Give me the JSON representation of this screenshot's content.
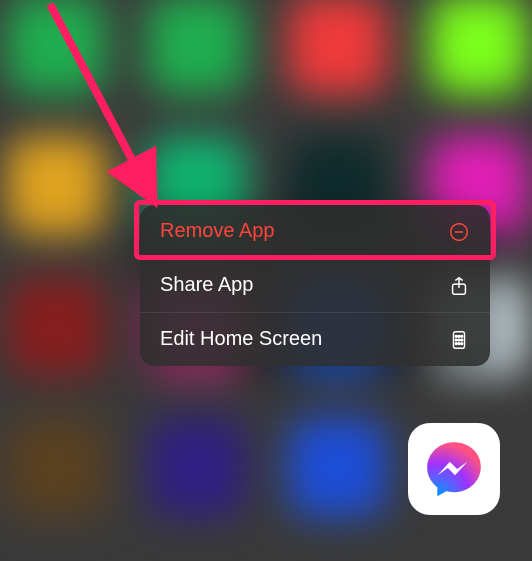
{
  "context_menu": {
    "items": [
      {
        "label": "Remove App",
        "icon": "remove-icon",
        "danger": true
      },
      {
        "label": "Share App",
        "icon": "share-icon",
        "danger": false
      },
      {
        "label": "Edit Home Screen",
        "icon": "edit-home-icon",
        "danger": false
      }
    ]
  },
  "app": {
    "name": "Messenger"
  },
  "annotation": {
    "highlight_color": "#ff1e61"
  }
}
